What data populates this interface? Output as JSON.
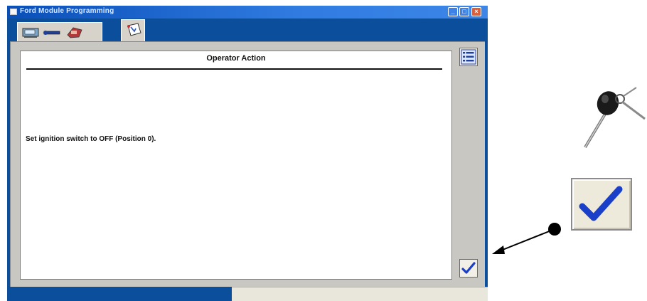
{
  "window": {
    "title": "Ford Module Programming",
    "controls": {
      "minimize": "_",
      "maximize": "□",
      "close": "×"
    }
  },
  "toolbar": {
    "tabs": [
      {
        "icon": "vehicle-id-icon"
      },
      {
        "icon": "wrench-icon"
      },
      {
        "icon": "engine-icon"
      },
      {
        "icon": "programming-tool-icon",
        "selected": true
      }
    ]
  },
  "panel": {
    "header": "Operator Action",
    "instruction": "Set ignition switch to OFF (Position 0)."
  },
  "side_buttons": {
    "list_icon": "list-icon",
    "ok_icon": "checkmark-icon"
  },
  "callouts": {
    "keys_icon": "ignition-key-icon",
    "enlarged_button_icon": "checkmark-icon"
  },
  "colors": {
    "window_blue": "#0b4f9c",
    "panel_gray": "#c8c7c2",
    "check_blue": "#1a3fc8"
  }
}
